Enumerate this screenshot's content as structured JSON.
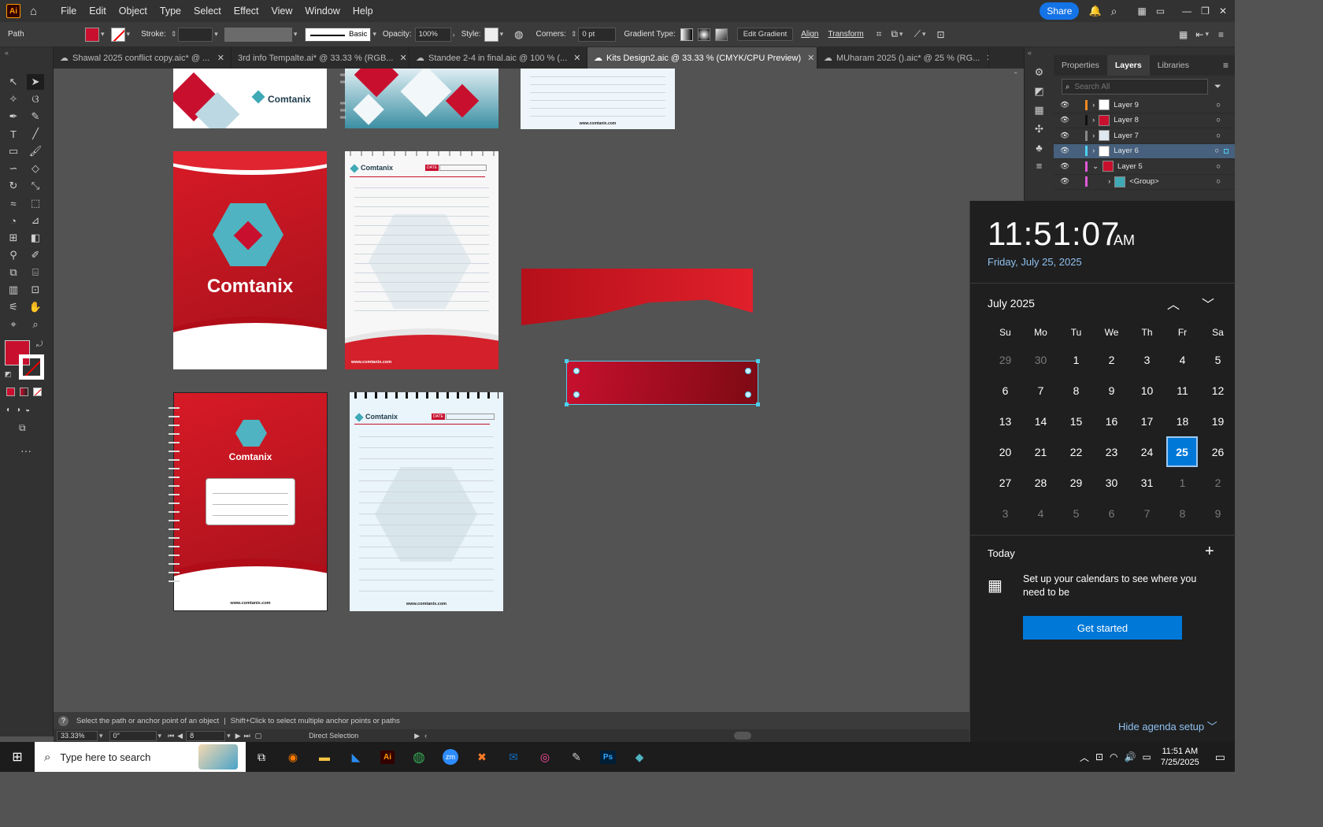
{
  "menubar": {
    "logo": "Ai",
    "items": [
      "File",
      "Edit",
      "Object",
      "Type",
      "Select",
      "Effect",
      "View",
      "Window",
      "Help"
    ],
    "share": "Share"
  },
  "control": {
    "selection": "Path",
    "stroke_label": "Stroke:",
    "brush": "Basic",
    "opacity_label": "Opacity:",
    "opacity": "100%",
    "style_label": "Style:",
    "corners_label": "Corners:",
    "corners": "0 pt",
    "gradient_type_label": "Gradient Type:",
    "edit_gradient": "Edit Gradient",
    "align": "Align",
    "transform": "Transform"
  },
  "tabs": [
    {
      "label": "Shawal 2025 conflict copy.aic* @ ..."
    },
    {
      "label": "3rd info Tempalte.ai* @ 33.33 % (RGB..."
    },
    {
      "label": "Standee 2-4 in final.aic @ 100 % (..."
    },
    {
      "label": "Kits Design2.aic @ 33.33 % (CMYK/CPU Preview)"
    },
    {
      "label": "MUharam 2025 ().aic* @ 25 % (RG..."
    }
  ],
  "artwork": {
    "brand": "Comtanix",
    "website": "www.comtanix.com",
    "date_tag": "DATE"
  },
  "status": {
    "hint": "Select the path or anchor point of an object",
    "hint2": "Shift+Click to select multiple anchor points or paths",
    "zoom": "33.33%",
    "rotation": "0°",
    "artboard": "8",
    "tool": "Direct Selection"
  },
  "panels": {
    "tabs": [
      "Properties",
      "Layers",
      "Libraries"
    ],
    "search_placeholder": "Search All",
    "layers": [
      {
        "name": "Layer 9",
        "color": "#f08a24"
      },
      {
        "name": "Layer 8",
        "color": "#111111"
      },
      {
        "name": "Layer 7",
        "color": "#888888"
      },
      {
        "name": "Layer 6",
        "color": "#4fd0f0"
      },
      {
        "name": "Layer 5",
        "color": "#e05bd8"
      },
      {
        "name": "<Group>",
        "color": "#e05bd8"
      }
    ]
  },
  "calendar": {
    "time": "11:51:07",
    "ampm": "AM",
    "date": "Friday, July 25, 2025",
    "month": "July 2025",
    "weekdays": [
      "Su",
      "Mo",
      "Tu",
      "We",
      "Th",
      "Fr",
      "Sa"
    ],
    "days": [
      [
        "29",
        "30",
        "1",
        "2",
        "3",
        "4",
        "5"
      ],
      [
        "6",
        "7",
        "8",
        "9",
        "10",
        "11",
        "12"
      ],
      [
        "13",
        "14",
        "15",
        "16",
        "17",
        "18",
        "19"
      ],
      [
        "20",
        "21",
        "22",
        "23",
        "24",
        "25",
        "26"
      ],
      [
        "27",
        "28",
        "29",
        "30",
        "31",
        "1",
        "2"
      ],
      [
        "3",
        "4",
        "5",
        "6",
        "7",
        "8",
        "9"
      ]
    ],
    "today_label": "Today",
    "agenda_text": "Set up your calendars to see where you need to be",
    "get_started": "Get started",
    "hide_agenda": "Hide agenda setup"
  },
  "taskbar": {
    "search_placeholder": "Type here to search",
    "time": "11:51 AM",
    "date": "7/25/2025"
  }
}
